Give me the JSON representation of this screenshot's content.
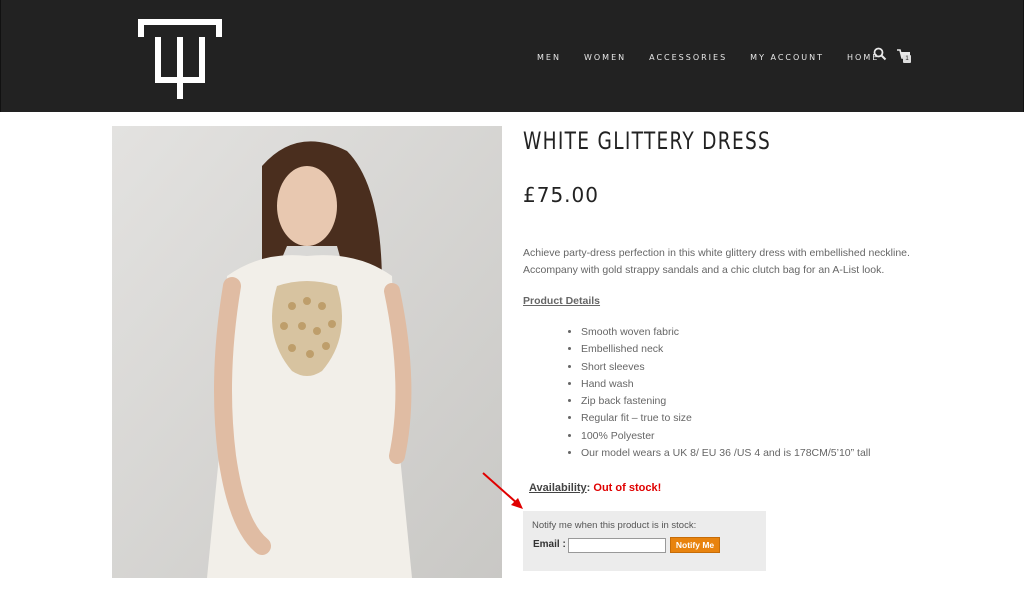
{
  "header": {
    "logo_icon": "tt-monogram-logo",
    "nav": [
      "MEN",
      "WOMEN",
      "ACCESSORIES",
      "MY ACCOUNT",
      "HOME"
    ],
    "search_icon": "search-icon",
    "cart_icon": "cart-icon",
    "cart_count": "1"
  },
  "product": {
    "title": "WHITE GLITTERY DRESS",
    "price": "£75.00",
    "description": [
      "Achieve party-dress perfection in this white glittery dress with embellished neckline.",
      "Accompany with gold strappy sandals and a chic clutch bag for an A-List look."
    ],
    "details_heading": "Product Details",
    "features": [
      "Smooth woven fabric",
      "Embellished neck",
      "Short sleeves",
      "Hand wash",
      "Zip back fastening",
      "Regular fit – true to size",
      "100% Polyester",
      "Our model wears a UK 8/ EU 36 /US 4 and is 178CM/5’10” tall"
    ]
  },
  "availability": {
    "label": "Availability",
    "colon": ":",
    "status": "Out of stock!"
  },
  "notify": {
    "text": "Notify me when this product is in stock:",
    "email_label": "Email :",
    "email_value": "",
    "button_label": "Notify Me"
  },
  "colors": {
    "header_bg": "#222222",
    "out_of_stock": "#e00000",
    "notify_button": "#e8830e",
    "annotation_arrow": "#e00000"
  }
}
